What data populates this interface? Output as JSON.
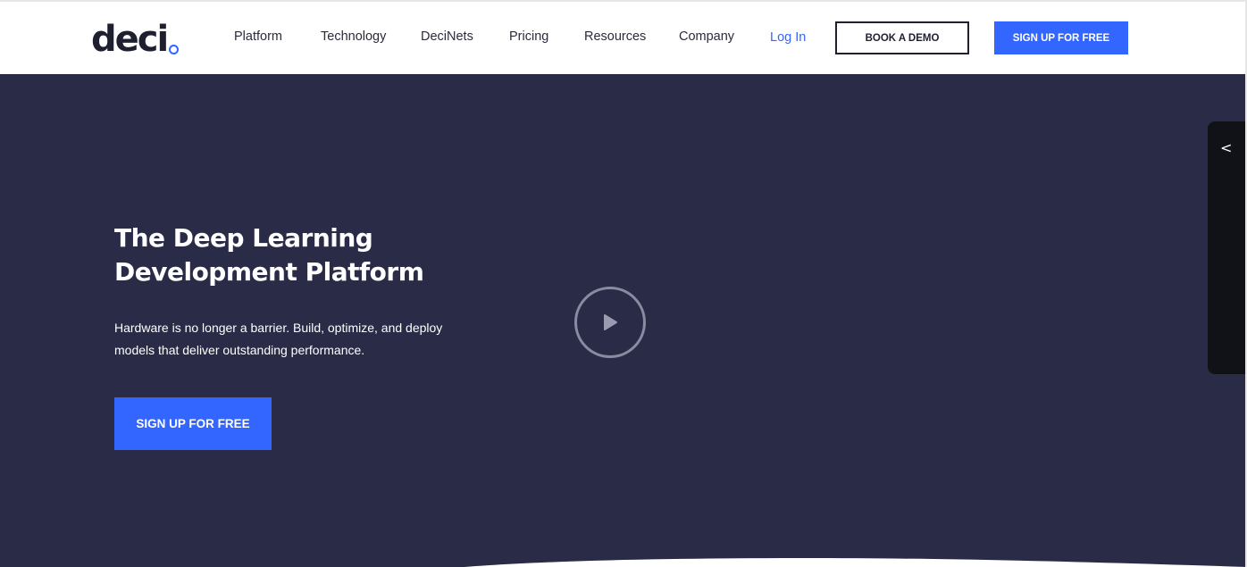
{
  "header": {
    "logo_text": "deci",
    "nav": [
      {
        "label": "Platform"
      },
      {
        "label": "Technology"
      },
      {
        "label": "DeciNets"
      },
      {
        "label": "Pricing"
      },
      {
        "label": "Resources"
      },
      {
        "label": "Company"
      }
    ],
    "login_label": "Log In",
    "demo_label": "BOOK A DEMO",
    "signup_label": "SIGN UP FOR FREE"
  },
  "hero": {
    "title": "The Deep Learning Development Platform",
    "subtitle": "Hardware is no longer a barrier. Build, optimize, and deploy models that deliver outstanding performance.",
    "cta_label": "SIGN UP FOR FREE",
    "play_icon": "play-icon"
  },
  "side_panel": {
    "arrow": "<",
    "arrow_icon": "chevron-left-icon"
  },
  "colors": {
    "brand_blue": "#3366ff",
    "hero_bg": "#2a2b47",
    "dark_text": "#1e2030"
  }
}
